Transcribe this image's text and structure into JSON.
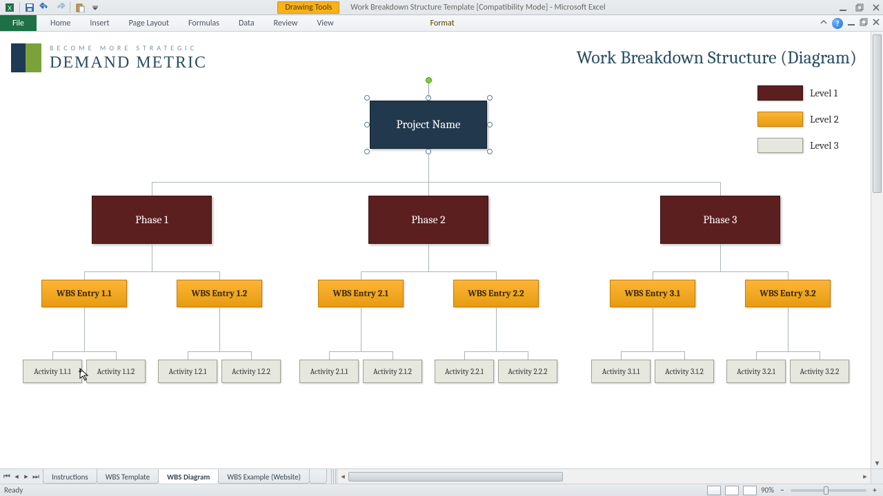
{
  "window": {
    "doc_title": "Work Breakdown Structure Template  [Compatibility Mode]  -  Microsoft Excel",
    "drawing_tools_label": "Drawing Tools"
  },
  "ribbon": {
    "file": "File",
    "tabs": [
      "Home",
      "Insert",
      "Page Layout",
      "Formulas",
      "Data",
      "Review",
      "View"
    ],
    "context_tab": "Format"
  },
  "logo": {
    "tagline": "Become More Strategic",
    "brand": "DEMAND METRIC"
  },
  "page_title": "Work Breakdown Structure (Diagram)",
  "legend": {
    "l1": "Level 1",
    "l2": "Level 2",
    "l3": "Level 3"
  },
  "wbs": {
    "root": "Project Name",
    "phases": [
      {
        "name": "Phase 1",
        "entries": [
          {
            "name": "WBS Entry 1.1",
            "activities": [
              "Activity 1.1.1",
              "Activity 1.1.2"
            ]
          },
          {
            "name": "WBS Entry 1.2",
            "activities": [
              "Activity 1.2.1",
              "Activity 1.2.2"
            ]
          }
        ]
      },
      {
        "name": "Phase 2",
        "entries": [
          {
            "name": "WBS Entry 2.1",
            "activities": [
              "Activity 2.1.1",
              "Activity 2.1.2"
            ]
          },
          {
            "name": "WBS Entry 2.2",
            "activities": [
              "Activity 2.2.1",
              "Activity 2.2.2"
            ]
          }
        ]
      },
      {
        "name": "Phase 3",
        "entries": [
          {
            "name": "WBS Entry 3.1",
            "activities": [
              "Activity 3.1.1",
              "Activity 3.1.2"
            ]
          },
          {
            "name": "WBS Entry 3.2",
            "activities": [
              "Activity 3.2.1",
              "Activity 3.2.2"
            ]
          }
        ]
      }
    ]
  },
  "sheet_tabs": {
    "items": [
      "Instructions",
      "WBS Template",
      "WBS Diagram",
      "WBS Example (Website)"
    ],
    "active_index": 2
  },
  "status": {
    "left": "Ready",
    "zoom": "90%"
  }
}
